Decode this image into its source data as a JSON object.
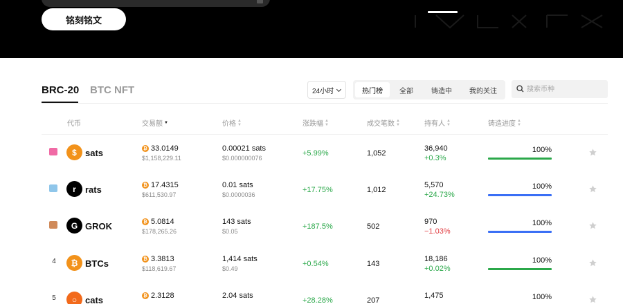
{
  "hero": {
    "inscribe_label": "铭刻铭文"
  },
  "tabs": {
    "brc20": "BRC-20",
    "nft": "BTC NFT"
  },
  "filters": {
    "time_range": "24小时",
    "segments": [
      "热门榜",
      "全部",
      "铸造中",
      "我的关注"
    ],
    "active_segment": "热门榜",
    "search_placeholder": "搜索币种"
  },
  "columns": {
    "token": "代币",
    "volume": "交易额",
    "price": "价格",
    "change": "涨跌幅",
    "txs": "成交笔数",
    "holders": "持有人",
    "mint": "铸造进度"
  },
  "colors": {
    "btc_orange": "#f2921b",
    "positive": "#2ba84a",
    "negative": "#e0393e",
    "bar_green": "#2ba84a",
    "bar_blue": "#3a6ff5"
  },
  "rows": [
    {
      "rank": "",
      "rank_badge": "gold-trophy-icon",
      "badge_color": "#f06aa5",
      "icon": "dollar-coin-icon",
      "icon_glyph": "$",
      "icon_color": "#f2921b",
      "name": "sats",
      "volume": "33.0149",
      "volume_usd": "$1,158,229.11",
      "price": "0.00021 sats",
      "price_usd": "$0.000000076",
      "change": "+5.99%",
      "txs": "1,052",
      "holders": "36,940",
      "holders_change": "+0.3%",
      "holders_dir": "pos",
      "mint": "100%",
      "mint_fraction": 1.0,
      "bar_color": "#2ba84a"
    },
    {
      "rank": "",
      "rank_badge": "silver-trophy-icon",
      "badge_color": "#8fc6ea",
      "icon": "rats-logo-icon",
      "icon_glyph": "r",
      "icon_color": "#000000",
      "name": "rats",
      "volume": "17.4315",
      "volume_usd": "$611,530.97",
      "price": "0.01 sats",
      "price_usd": "$0.0000036",
      "change": "+17.75%",
      "txs": "1,012",
      "holders": "5,570",
      "holders_change": "+24.73%",
      "holders_dir": "pos",
      "mint": "100%",
      "mint_fraction": 1.0,
      "bar_color": "#3a6ff5"
    },
    {
      "rank": "",
      "rank_badge": "bronze-trophy-icon",
      "badge_color": "#d08a5a",
      "icon": "grok-logo-icon",
      "icon_glyph": "G",
      "icon_color": "#000000",
      "name": "GROK",
      "volume": "5.0814",
      "volume_usd": "$178,265.26",
      "price": "143 sats",
      "price_usd": "$0.05",
      "change": "+187.5%",
      "txs": "502",
      "holders": "970",
      "holders_change": "−1.03%",
      "holders_dir": "neg",
      "mint": "100%",
      "mint_fraction": 1.0,
      "bar_color": "#3a6ff5"
    },
    {
      "rank": "4",
      "rank_badge": "",
      "badge_color": "",
      "icon": "bitcoin-coin-icon",
      "icon_glyph": "₿",
      "icon_color": "#f2921b",
      "name": "BTCs",
      "volume": "3.3813",
      "volume_usd": "$118,619.67",
      "price": "1,414 sats",
      "price_usd": "$0.49",
      "change": "+0.54%",
      "txs": "143",
      "holders": "18,186",
      "holders_change": "+0.02%",
      "holders_dir": "pos",
      "mint": "100%",
      "mint_fraction": 1.0,
      "bar_color": "#2ba84a"
    },
    {
      "rank": "5",
      "rank_badge": "",
      "badge_color": "",
      "icon": "cats-logo-icon",
      "icon_glyph": "○",
      "icon_color": "#f26a1b",
      "name": "cats",
      "volume": "2.3128",
      "volume_usd": "",
      "price": "2.04 sats",
      "price_usd": "",
      "change": "+28.28%",
      "txs": "207",
      "holders": "1,475",
      "holders_change": "",
      "holders_dir": "neg",
      "mint": "100%",
      "mint_fraction": 1.0,
      "bar_color": "#2ba84a"
    }
  ]
}
